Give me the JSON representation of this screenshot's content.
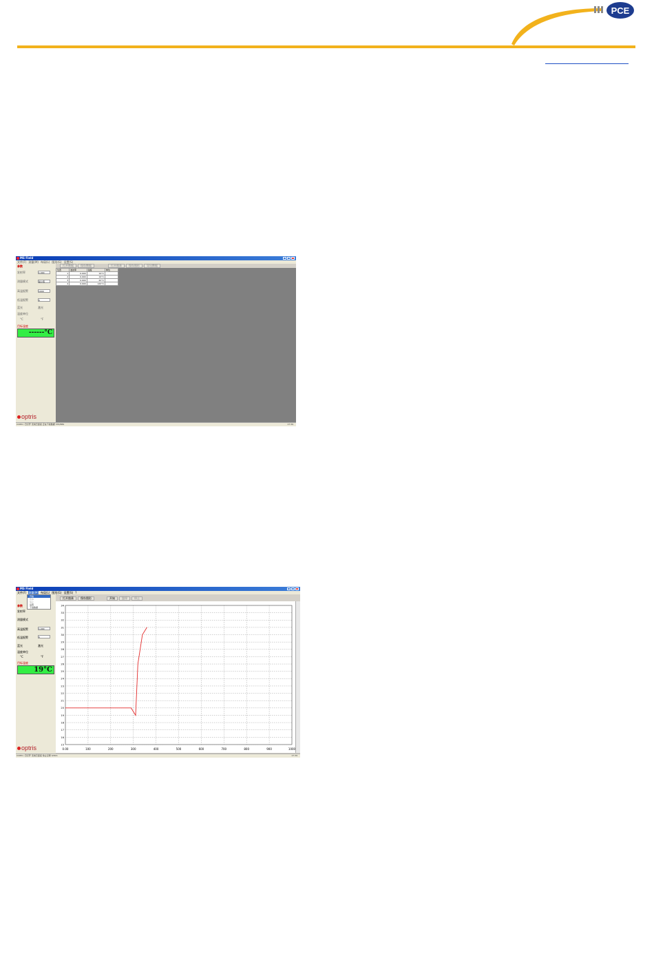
{
  "header": {
    "link_text": ""
  },
  "window1": {
    "title": "MS Field",
    "menu": [
      "文件(F)",
      "测量(M)",
      "布局(L)",
      "图形(G)",
      "设置(S)"
    ],
    "toolbar": [
      "打开数据",
      "保存数据",
      "",
      "打开图表",
      "保存图形",
      "导出数据"
    ],
    "params_label": "参数",
    "rows": [
      {
        "label": "发射率",
        "value": "1.000"
      },
      {
        "label": "测量模式",
        "value": "最小值"
      },
      {
        "label": "高温报警",
        "value": "1000"
      },
      {
        "label": "低温报警",
        "value": "0"
      }
    ],
    "check_row": [
      "蓝光",
      "激光"
    ],
    "unit_group": "温度单位",
    "units": [
      "°C",
      "°F"
    ],
    "temp_label": "目标温度",
    "temp_value": "------°C",
    "table": {
      "headers": [
        "位置",
        "发射率",
        "温度",
        "单位"
      ],
      "rows": [
        [
          "1",
          "0.900",
          "19°C",
          ""
        ],
        [
          "2",
          "0.900",
          "19°C",
          ""
        ],
        [
          "3",
          "0.900",
          "20°C",
          ""
        ],
        [
          "4",
          "0.900",
          "120°C",
          ""
        ]
      ]
    },
    "status": "COM4 / 已打开  无线已连接  正在下载数据  333/889",
    "clock": "17:39",
    "brand": "optris"
  },
  "window2": {
    "title": "MS Field",
    "menu": [
      "文件(F)",
      "测量(M)",
      "布局(L)",
      "图形(G)",
      "设置(S)",
      "?"
    ],
    "dropdown": [
      {
        "label": "开始",
        "state": "sel"
      },
      {
        "label": "暂停",
        "state": "dis"
      },
      {
        "label": "停止",
        "state": "dis"
      },
      {
        "label": "设置",
        "state": ""
      },
      {
        "label": "下载数据",
        "state": ""
      }
    ],
    "toolbar": [
      "打开图表",
      "保存图形",
      "",
      "开始",
      "暂停",
      "停止"
    ],
    "params_label": "参数",
    "rows": [
      {
        "label": "发射率",
        "value": ""
      },
      {
        "label": "测量模式",
        "value": ""
      },
      {
        "label": "高温报警",
        "value": "1,000"
      },
      {
        "label": "低温报警",
        "value": "0"
      }
    ],
    "check_row": [
      "蓝光",
      "激光"
    ],
    "unit_group": "温度单位",
    "units": [
      "°C",
      "°F"
    ],
    "temp_label": "目标温度",
    "temp_value": "19°C",
    "status": "COM4 / 已打开  无线已连接  停止记录  0/00A",
    "clock": "17:39",
    "brand": "optris"
  },
  "chart_data": {
    "type": "line",
    "x": [
      0,
      100,
      200,
      290,
      310,
      320,
      340,
      360
    ],
    "series": [
      {
        "values": [
          20,
          20,
          20,
          20,
          19,
          26,
          30,
          31
        ]
      }
    ],
    "xticks": [
      "0.00",
      "100",
      "200",
      "300",
      "400",
      "500",
      "600",
      "700",
      "800",
      "900",
      "1000"
    ],
    "yticks": [
      "15",
      "16",
      "17",
      "18",
      "19",
      "20",
      "21",
      "22",
      "23",
      "24",
      "25",
      "26",
      "27",
      "28",
      "29",
      "30",
      "31",
      "32",
      "33",
      "34"
    ],
    "xlim": [
      0,
      1000
    ],
    "ylim": [
      15,
      34
    ],
    "grid": true,
    "line_color": "#e32b2b"
  }
}
